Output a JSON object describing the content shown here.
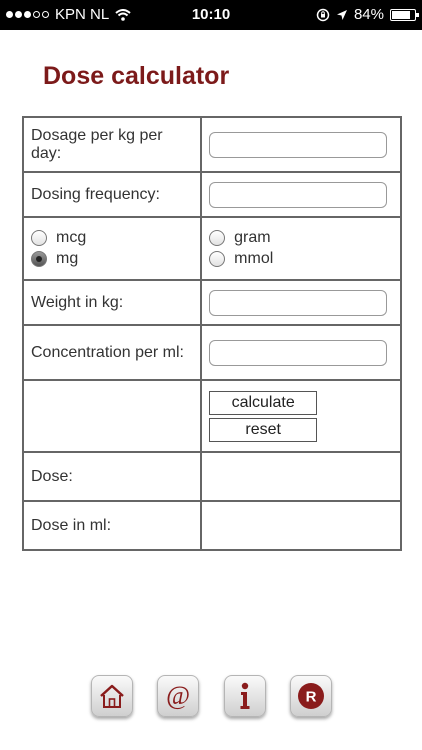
{
  "status_bar": {
    "carrier": "KPN NL",
    "time": "10:10",
    "battery": "84%",
    "battery_level": 0.84
  },
  "page_title": "Dose calculator",
  "form": {
    "dosage_label": "Dosage per kg per day:",
    "frequency_label": "Dosing frequency:",
    "units": {
      "mcg": "mcg",
      "mg": "mg",
      "gram": "gram",
      "mmol": "mmol",
      "selected": "mg"
    },
    "weight_label": "Weight in kg:",
    "concentration_label": "Concentration per ml:",
    "calculate_label": "calculate",
    "reset_label": "reset",
    "dose_label": "Dose:",
    "dose_ml_label": "Dose in ml:",
    "dose_value": "",
    "dose_ml_value": ""
  },
  "toolbar": {
    "icons": [
      "home-icon",
      "at-icon",
      "info-icon",
      "r-icon"
    ],
    "accent": "#8a1c1c"
  }
}
